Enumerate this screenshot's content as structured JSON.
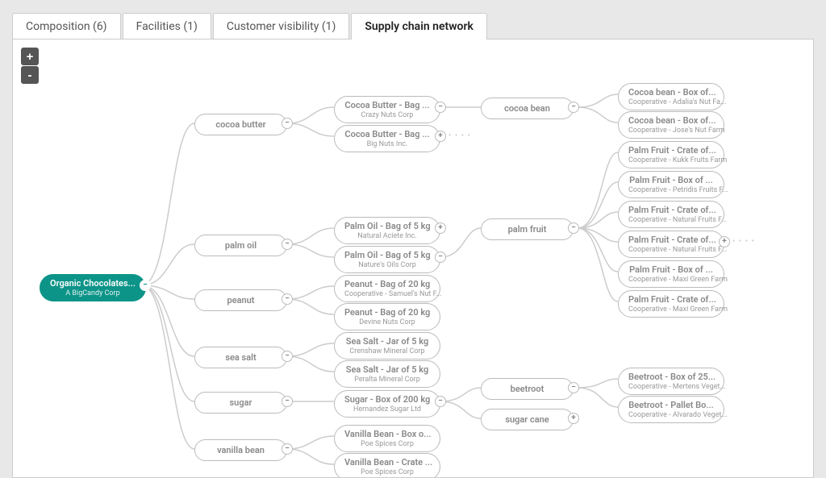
{
  "tabs": [
    {
      "label": "Composition (6)"
    },
    {
      "label": "Facilities (1)"
    },
    {
      "label": "Customer visibility (1)"
    },
    {
      "label": "Supply chain network"
    }
  ],
  "zoom": {
    "in": "+",
    "out": "-"
  },
  "root": {
    "title": "Organic Chocolates...",
    "sub": "A BigCandy Corp"
  },
  "cats": {
    "cocoa_butter": "cocoa butter",
    "palm_oil": "palm oil",
    "peanut": "peanut",
    "sea_salt": "sea salt",
    "sugar": "sugar",
    "vanilla": "vanilla bean"
  },
  "mid": {
    "cb1": {
      "t": "Cocoa Butter - Bag ...",
      "s": "Crazy Nuts Corp"
    },
    "cb2": {
      "t": "Cocoa Butter - Bag ...",
      "s": "Big Nuts Inc."
    },
    "po1": {
      "t": "Palm Oil - Bag of 5 kg",
      "s": "Natural Aciete Inc."
    },
    "po2": {
      "t": "Palm Oil - Bag of 5 kg",
      "s": "Nature's Oils Corp"
    },
    "pn1": {
      "t": "Peanut - Bag of 20 kg",
      "s": "Cooperative - Samuel's Nut F..."
    },
    "pn2": {
      "t": "Peanut - Bag of 20 kg",
      "s": "Devine Nuts Corp"
    },
    "ss1": {
      "t": "Sea Salt - Jar of 5 kg",
      "s": "Crenshaw Mineral Corp"
    },
    "ss2": {
      "t": "Sea Salt - Jar of 5 kg",
      "s": "Peralta Mineral Corp"
    },
    "sg1": {
      "t": "Sugar - Box of 200 kg",
      "s": "Hernandez Sugar Ltd"
    },
    "vb1": {
      "t": "Vanilla Bean - Box o...",
      "s": "Poe Spices Corp"
    },
    "vb2": {
      "t": "Vanilla Bean - Crate ...",
      "s": "Poe Spices Corp"
    }
  },
  "sub": {
    "cocoa_bean": "cocoa bean",
    "palm_fruit": "palm fruit",
    "beetroot": "beetroot",
    "sugar_cane": "sugar cane"
  },
  "leaf": {
    "cbn1": {
      "t": "Cocoa bean - Box of...",
      "s": "Cooperative - Adalia's Nut Fa..."
    },
    "cbn2": {
      "t": "Cocoa bean - Box of...",
      "s": "Cooperative - Jose's Nut Farm"
    },
    "pf1": {
      "t": "Palm Fruit - Crate of...",
      "s": "Cooperative - Kukk Fruits Farm"
    },
    "pf2": {
      "t": "Palm Fruit - Box of ...",
      "s": "Cooperative - Petridis Fruits F..."
    },
    "pf3": {
      "t": "Palm Fruit - Crate of...",
      "s": "Cooperative - Natural Fruits F..."
    },
    "pf4": {
      "t": "Palm Fruit - Crate of...",
      "s": "Cooperative - Natural Fruits F..."
    },
    "pf5": {
      "t": "Palm Fruit - Box of ...",
      "s": "Cooperative - Maxi Green Farm"
    },
    "pf6": {
      "t": "Palm Fruit - Crate of...",
      "s": "Cooperative - Maxi Green Farm"
    },
    "br1": {
      "t": "Beetroot - Box of 25...",
      "s": "Cooperative - Mertens Veget..."
    },
    "br2": {
      "t": "Beetroot - Pallet Bo...",
      "s": "Cooperative - Alvarado Veget..."
    }
  },
  "toggle": {
    "minus": "−",
    "plus": "+"
  }
}
